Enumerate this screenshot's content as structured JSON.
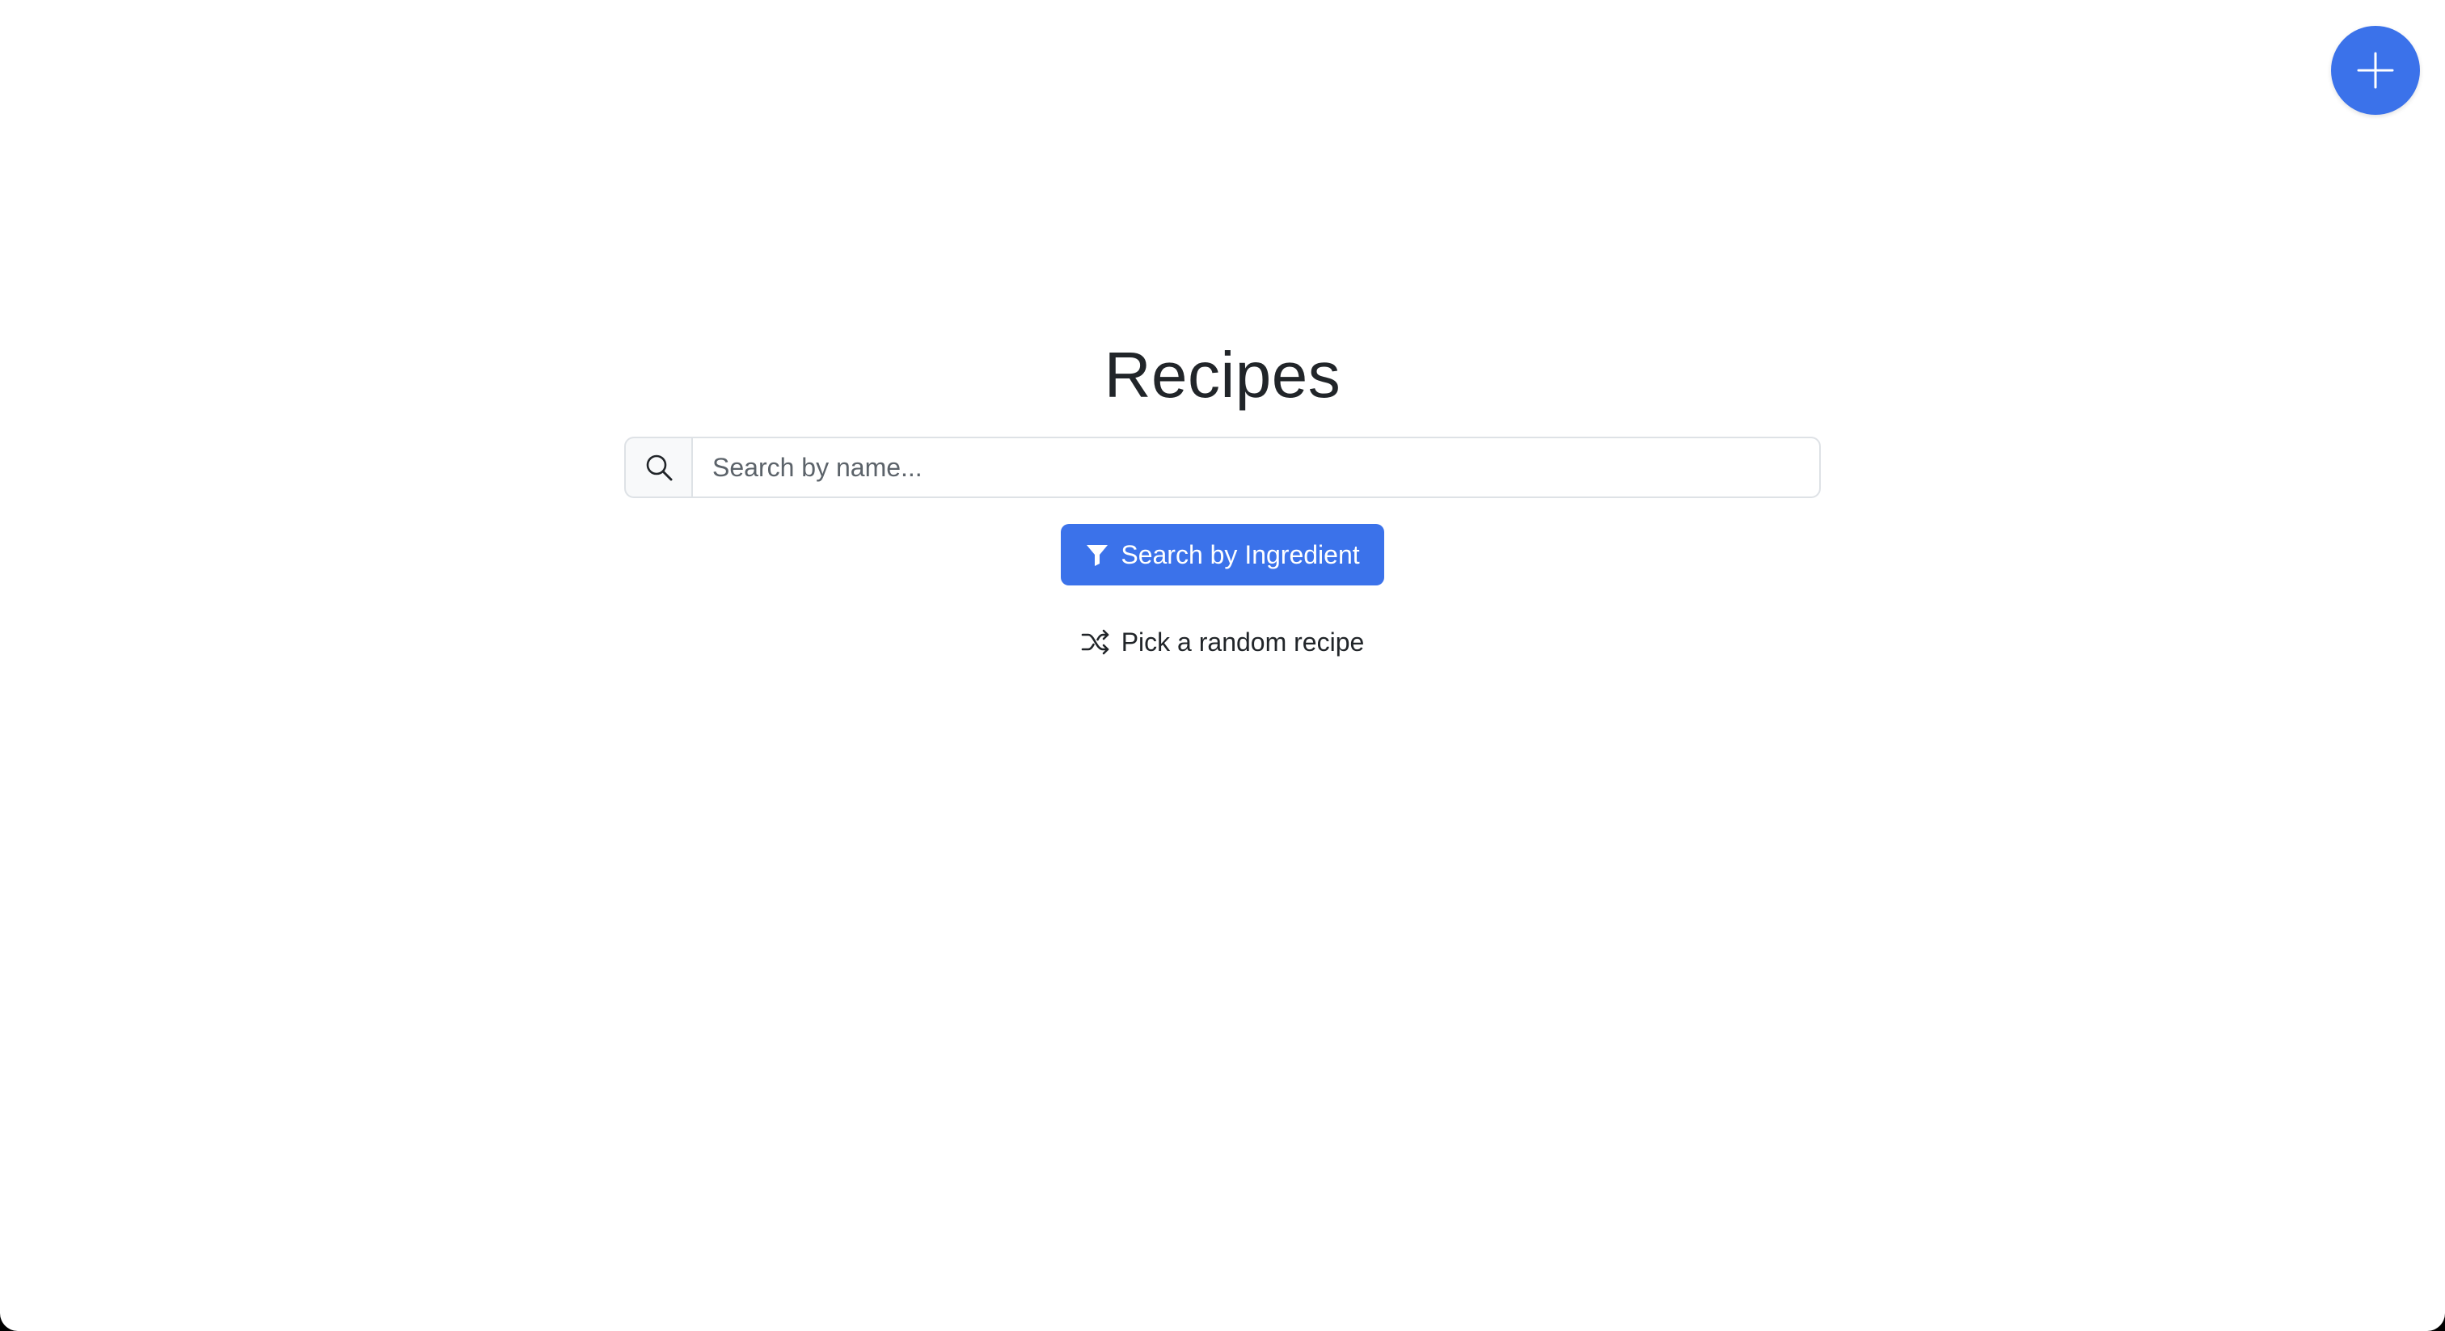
{
  "app": {
    "title": "Recipes"
  },
  "fab": {
    "icon": "plus-icon",
    "color": "#3b72ea"
  },
  "search": {
    "icon": "search-icon",
    "placeholder": "Search by name...",
    "value": ""
  },
  "ingredient_button": {
    "icon": "funnel-icon",
    "label": "Search by Ingredient",
    "color": "#3b72ea"
  },
  "random": {
    "icon": "shuffle-icon",
    "label": "Pick a random recipe"
  }
}
